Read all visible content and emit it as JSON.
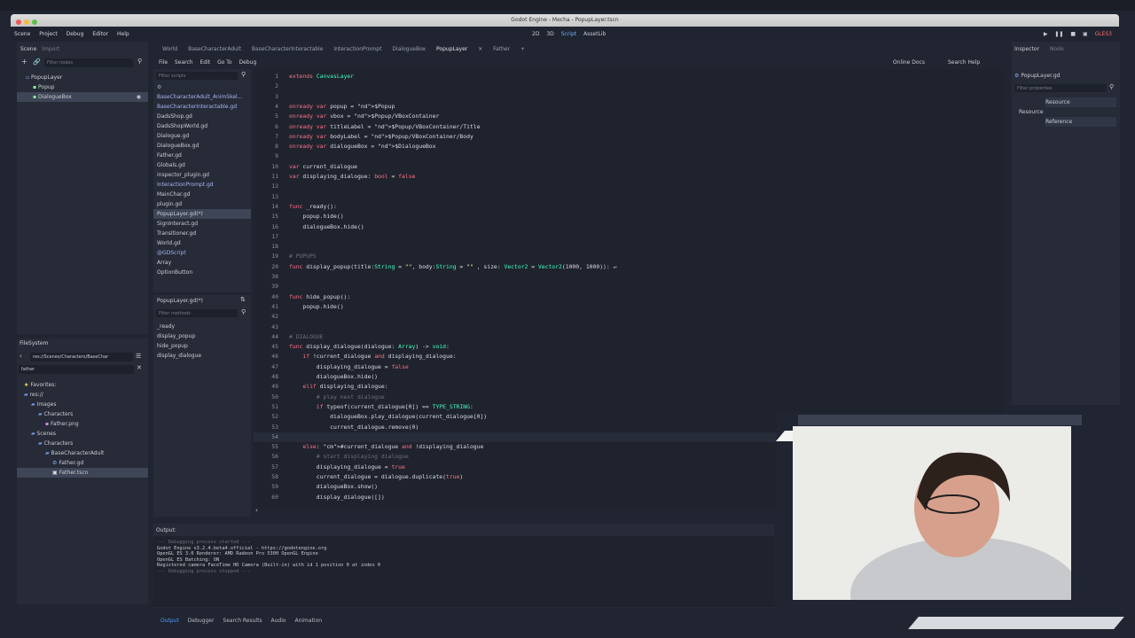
{
  "window_title": "Godot Engine - Mecha - PopupLayer.tscn",
  "main_menu": [
    "Scene",
    "Project",
    "Debug",
    "Editor",
    "Help"
  ],
  "workspace_modes": [
    "2D",
    "3D",
    "Script",
    "AssetLib"
  ],
  "renderer": "GLES3",
  "scene_dock": {
    "tabs": [
      "Scene",
      "Import"
    ],
    "filter_placeholder": "Filter nodes",
    "tree": [
      "PopupLayer",
      "Popup",
      "DialogueBox"
    ]
  },
  "filesystem_dock": {
    "title": "FileSystem",
    "path": "res://Scenes/Characters/BaseChar",
    "search": "father",
    "tree": [
      "Favorites:",
      "res://",
      "Images",
      "Characters",
      "Father.png",
      "Scenes",
      "Characters",
      "BaseCharacterAdult",
      "Father.gd",
      "Father.tscn"
    ]
  },
  "editor_tabs": [
    "World",
    "BaseCharacterAdult",
    "BaseCharacterInteractable",
    "InteractionPrompt",
    "DialogueBox",
    "PopupLayer",
    "Father"
  ],
  "script_menu": [
    "File",
    "Search",
    "Edit",
    "Go To",
    "Debug"
  ],
  "online_docs": "Online Docs",
  "search_help": "Search Help",
  "scripts_filter_placeholder": "Filter scripts",
  "scripts": [
    "BaseCharacterAdult_AnimSkel...",
    "BaseCharacterInteractable.gd",
    "DadsShop.gd",
    "DadsShopWorld.gd",
    "Dialogue.gd",
    "DialogueBox.gd",
    "Father.gd",
    "Globals.gd",
    "inspector_plugin.gd",
    "InteractionPrompt.gd",
    "MainChar.gd",
    "plugin.gd",
    "PopupLayer.gd(*)",
    "SignInteract.gd",
    "Transitioner.gd",
    "World.gd",
    "@GDScript",
    "Array",
    "OptionButton"
  ],
  "current_script": "PopupLayer.gd(*)",
  "methods_filter_placeholder": "Filter methods",
  "methods": [
    "_ready",
    "display_popup",
    "hide_popup",
    "display_dialogue"
  ],
  "inspector": {
    "tabs": [
      "Inspector",
      "Node"
    ],
    "object": "PopupLayer.gd",
    "filter_placeholder": "Filter properties",
    "items": [
      "Resource",
      "Resource",
      "Reference"
    ]
  },
  "code": [
    {
      "n": "1",
      "t": "extends CanvasLayer"
    },
    {
      "n": "2",
      "t": ""
    },
    {
      "n": "3",
      "t": ""
    },
    {
      "n": "4",
      "t": "onready var popup = $Popup"
    },
    {
      "n": "5",
      "t": "onready var vbox = $Popup/VBoxContainer"
    },
    {
      "n": "6",
      "t": "onready var titleLabel = $Popup/VBoxContainer/Title"
    },
    {
      "n": "7",
      "t": "onready var bodyLabel = $Popup/VBoxContainer/Body"
    },
    {
      "n": "8",
      "t": "onready var dialogueBox = $DialogueBox"
    },
    {
      "n": "9",
      "t": ""
    },
    {
      "n": "10",
      "t": "var current_dialogue"
    },
    {
      "n": "11",
      "t": "var displaying_dialogue: bool = false"
    },
    {
      "n": "12",
      "t": ""
    },
    {
      "n": "13",
      "t": ""
    },
    {
      "n": "14",
      "t": "func _ready():"
    },
    {
      "n": "15",
      "t": "    popup.hide()"
    },
    {
      "n": "16",
      "t": "    dialogueBox.hide()"
    },
    {
      "n": "17",
      "t": ""
    },
    {
      "n": "18",
      "t": ""
    },
    {
      "n": "19",
      "t": "# POPUPS"
    },
    {
      "n": "20",
      "t": "func display_popup(title:String = \"\", body:String = \"\" , size: Vector2 = Vector2(1000, 1000)): ↵"
    },
    {
      "n": "38",
      "t": ""
    },
    {
      "n": "39",
      "t": ""
    },
    {
      "n": "40",
      "t": "func hide_popup():"
    },
    {
      "n": "41",
      "t": "    popup.hide()"
    },
    {
      "n": "42",
      "t": ""
    },
    {
      "n": "43",
      "t": ""
    },
    {
      "n": "44",
      "t": "# DIALOGUE"
    },
    {
      "n": "45",
      "t": "func display_dialogue(dialogue: Array) -> void:"
    },
    {
      "n": "46",
      "t": "    if !current_dialogue and displaying_dialogue:"
    },
    {
      "n": "47",
      "t": "        displaying_dialogue = false"
    },
    {
      "n": "48",
      "t": "        dialogueBox.hide()"
    },
    {
      "n": "49",
      "t": "    elif displaying_dialogue:"
    },
    {
      "n": "50",
      "t": "        # play next dialogue"
    },
    {
      "n": "51",
      "t": "        if typeof(current_dialogue[0]) == TYPE_STRING:"
    },
    {
      "n": "52",
      "t": "            dialogueBox.play_dialogue(current_dialogue[0])"
    },
    {
      "n": "53",
      "t": "            current_dialogue.remove(0)"
    },
    {
      "n": "54",
      "t": "        "
    },
    {
      "n": "55",
      "t": "    else: #current_dialogue and !displaying_dialogue"
    },
    {
      "n": "56",
      "t": "        # start displaying dialogue"
    },
    {
      "n": "57",
      "t": "        displaying_dialogue = true"
    },
    {
      "n": "58",
      "t": "        current_dialogue = dialogue.duplicate(true)"
    },
    {
      "n": "59",
      "t": "        dialogueBox.show()"
    },
    {
      "n": "60",
      "t": "        display_dialogue([])"
    }
  ],
  "output": {
    "title": "Output:",
    "lines": [
      "--- Debugging process started ---",
      "Godot Engine v3.2.4.beta4.official - https://godotengine.org",
      "OpenGL ES 3.0 Renderer: AMD Radeon Pro 5300 OpenGL Engine",
      "OpenGL ES Batching: ON",
      "",
      "Registered camera FaceTime HD Camera (Built-in) with id 1 position 0 at index 0",
      "--- Debugging process stopped ---"
    ]
  },
  "bottom_tabs": [
    "Output",
    "Debugger",
    "Search Results",
    "Audio",
    "Animation"
  ],
  "colors": {
    "accent": "#4d9bff",
    "background": "#202531",
    "keyword": "#ff7085",
    "string": "#ffeda1",
    "node_path": "#63c259"
  }
}
